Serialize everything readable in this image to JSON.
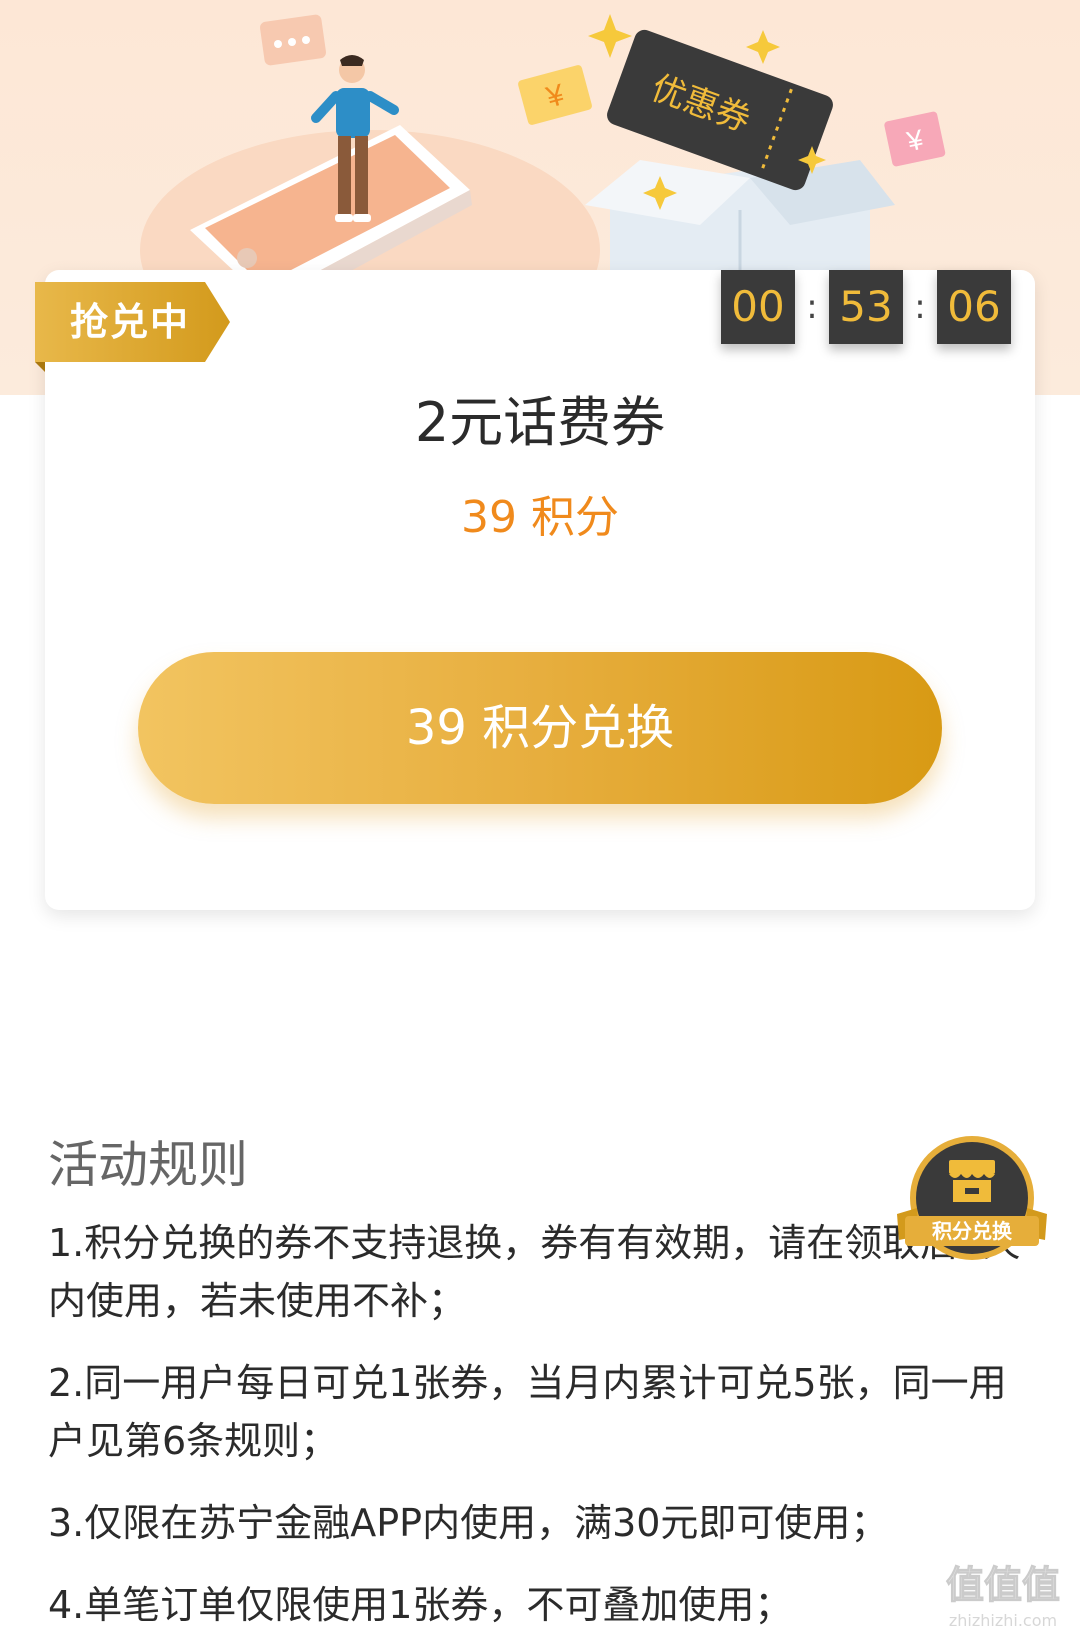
{
  "banner": {
    "coupon_art_label": "优惠券"
  },
  "card": {
    "status_ribbon": "抢兑中",
    "countdown": {
      "hours": "00",
      "minutes": "53",
      "seconds": "06",
      "separator": ":"
    },
    "title": "2元话费券",
    "price": "39 积分",
    "exchange_button": "39 积分兑换"
  },
  "rules": {
    "title": "活动规则",
    "items": [
      "1.积分兑换的券不支持退换，券有有效期，请在领取后3天内使用，若未使用不补；",
      "2.同一用户每日可兑1张券，当月内累计可兑5张，同一用户见第6条规则；",
      "3.仅限在苏宁金融APP内使用，满30元即可使用；",
      "4.单笔订单仅限使用1张券，不可叠加使用；"
    ]
  },
  "float_button": {
    "label": "积分兑换"
  },
  "watermark": {
    "logo": "值值值",
    "url": "zhizhizhi.com"
  },
  "colors": {
    "accent_gold": "#e7ae3e",
    "price_orange": "#f08a1c",
    "timer_bg": "#3a3a3a",
    "timer_text": "#f0bb3a",
    "banner_bg": "#fde7d6"
  }
}
